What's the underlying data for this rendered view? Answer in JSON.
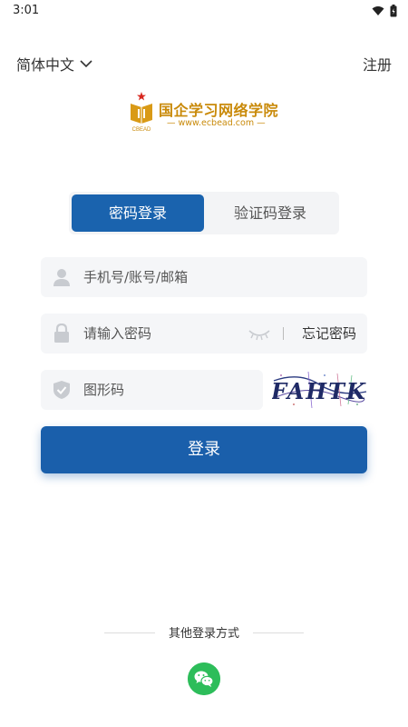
{
  "status_bar": {
    "time": "3:01",
    "icons": [
      "wifi-icon",
      "battery-icon"
    ]
  },
  "header": {
    "language": "简体中文",
    "register": "注册"
  },
  "logo": {
    "title": "国企学习网络学院",
    "url": "— www.ecbead.com —",
    "emblem_text": "CBEAD"
  },
  "tabs": [
    {
      "label": "密码登录",
      "active": true
    },
    {
      "label": "验证码登录",
      "active": false
    }
  ],
  "form": {
    "account_placeholder": "手机号/账号/邮箱",
    "password_placeholder": "请输入密码",
    "forgot_password": "忘记密码",
    "captcha_placeholder": "图形码",
    "captcha_text": "FAHTK",
    "login_button": "登录"
  },
  "other_login": {
    "title": "其他登录方式",
    "providers": [
      "wechat-icon"
    ]
  },
  "colors": {
    "primary": "#1a5fab",
    "brand_gold": "#c98a0a",
    "wechat": "#2dbd5a"
  }
}
